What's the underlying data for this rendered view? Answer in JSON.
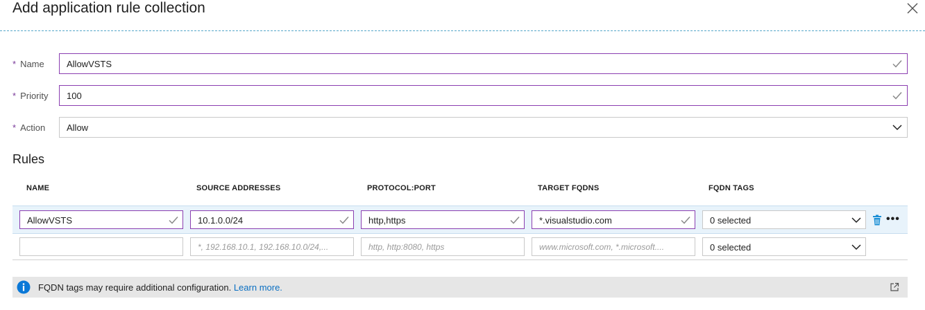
{
  "blade": {
    "title": "Add application rule collection"
  },
  "form": {
    "name": {
      "label": "Name",
      "value": "AllowVSTS"
    },
    "priority": {
      "label": "Priority",
      "value": "100"
    },
    "action": {
      "label": "Action",
      "value": "Allow"
    },
    "required_mark": "*"
  },
  "rules": {
    "title": "Rules",
    "columns": [
      "NAME",
      "SOURCE ADDRESSES",
      "PROTOCOL:PORT",
      "TARGET FQDNS",
      "FQDN TAGS"
    ],
    "rows": [
      {
        "name": "AllowVSTS",
        "source": "10.1.0.0/24",
        "protocol": "http,https",
        "target": "*.visualstudio.com",
        "tags": "0 selected"
      }
    ],
    "new_row": {
      "name": "",
      "source_placeholder": "*, 192.168.10.1, 192.168.10.0/24,...",
      "protocol_placeholder": "http, http:8080, https",
      "target_placeholder": "www.microsoft.com, *.microsoft....",
      "tags": "0 selected"
    },
    "more_label": "•••"
  },
  "info": {
    "text": "FQDN tags may require additional configuration.",
    "link": "Learn more."
  },
  "colors": {
    "accent_purple": "#8a3db0",
    "link_blue": "#0a6fc2",
    "info_blue": "#0a78d7",
    "row_highlight": "#e8f3fb"
  }
}
